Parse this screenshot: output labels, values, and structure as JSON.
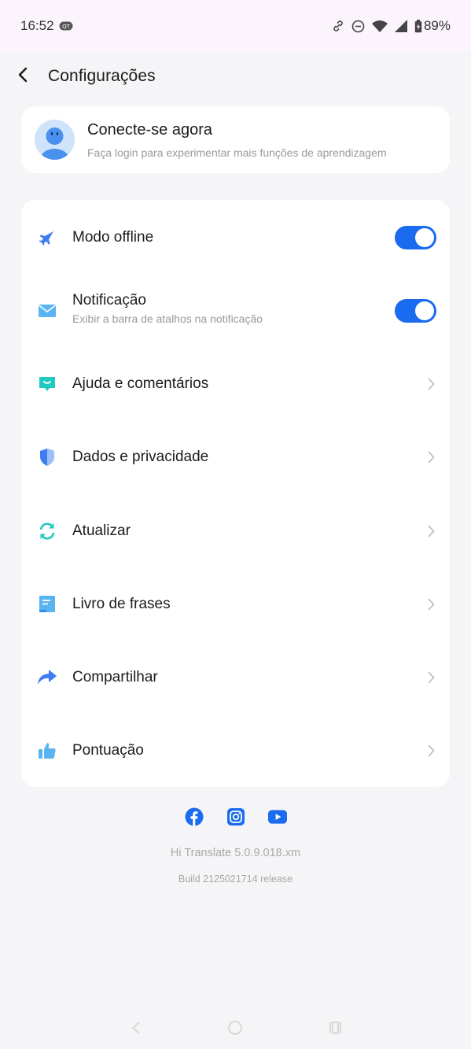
{
  "status_bar": {
    "time": "16:52",
    "battery": "89%",
    "icons": [
      "notification-badge-icon",
      "link-icon",
      "dnd-icon",
      "wifi-icon",
      "signal-icon",
      "battery-icon"
    ]
  },
  "header": {
    "back_icon": "chevron-left-icon",
    "title": "Configurações"
  },
  "login": {
    "title": "Conecte-se agora",
    "subtitle": "Faça login para experimentar mais funções de aprendizagem"
  },
  "settings": {
    "items": [
      {
        "label": "Modo offline",
        "icon": "airplane-icon",
        "control": "toggle",
        "on": true
      },
      {
        "label": "Notificação",
        "sublabel": "Exibir a barra de atalhos na notificação",
        "icon": "mail-icon",
        "control": "toggle",
        "on": true
      },
      {
        "label": "Ajuda e comentários",
        "icon": "feedback-icon",
        "control": "chevron"
      },
      {
        "label": "Dados e privacidade",
        "icon": "shield-icon",
        "control": "chevron"
      },
      {
        "label": "Atualizar",
        "icon": "refresh-icon",
        "control": "chevron"
      },
      {
        "label": "Livro de frases",
        "icon": "phrasebook-icon",
        "control": "chevron"
      },
      {
        "label": "Compartilhar",
        "icon": "share-icon",
        "control": "chevron"
      },
      {
        "label": "Pontuação",
        "icon": "thumbs-up-icon",
        "control": "chevron"
      }
    ]
  },
  "footer": {
    "socials": [
      "facebook-icon",
      "instagram-icon",
      "youtube-icon"
    ],
    "version": "Hi Translate  5.0.9.018.xm",
    "build": "Build 2125021714 release"
  },
  "colors": {
    "accent": "#1a6bf0",
    "background": "#f5f5f7",
    "card": "#ffffff",
    "status_bar": "#fbf4fc"
  }
}
